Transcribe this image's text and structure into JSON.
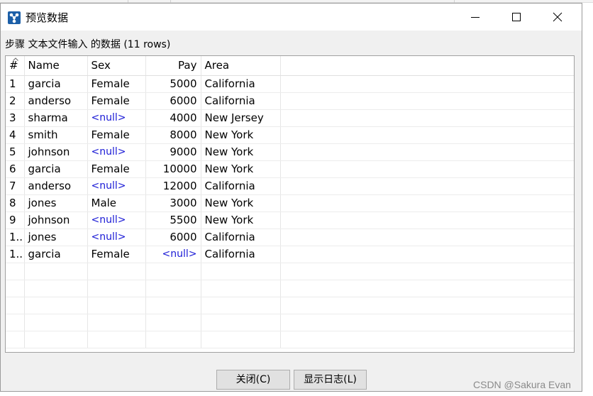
{
  "window": {
    "title": "预览数据",
    "accent": "#1c5fa8"
  },
  "caption": "步骤 文本文件输入 的数据  (11 rows)",
  "table": {
    "columns": [
      "#",
      "Name",
      "Sex",
      "Pay",
      "Area"
    ],
    "rows": [
      [
        "1",
        "garcia",
        "Female",
        "5000",
        "California"
      ],
      [
        "2",
        "anderso",
        "Female",
        "6000",
        "California"
      ],
      [
        "3",
        "sharma",
        "<null>",
        "4000",
        "New Jersey"
      ],
      [
        "4",
        "smith",
        "Female",
        "8000",
        "New York"
      ],
      [
        "5",
        "johnson",
        "<null>",
        "9000",
        "New York"
      ],
      [
        "6",
        "garcia",
        "Female",
        "10000",
        "New York"
      ],
      [
        "7",
        "anderso",
        "<null>",
        "12000",
        "California"
      ],
      [
        "8",
        "jones",
        "Male",
        "3000",
        "New York"
      ],
      [
        "9",
        "johnson",
        "<null>",
        "5500",
        "New York"
      ],
      [
        "1..",
        "jones",
        "<null>",
        "6000",
        "California"
      ],
      [
        "1..",
        "garcia",
        "Female",
        "<null>",
        "California"
      ]
    ],
    "null_color": "#1a1ad6"
  },
  "buttons": {
    "close_label": "关闭(C)",
    "log_label": "显示日志(L)"
  },
  "watermark": "CSDN @Sakura Evan"
}
